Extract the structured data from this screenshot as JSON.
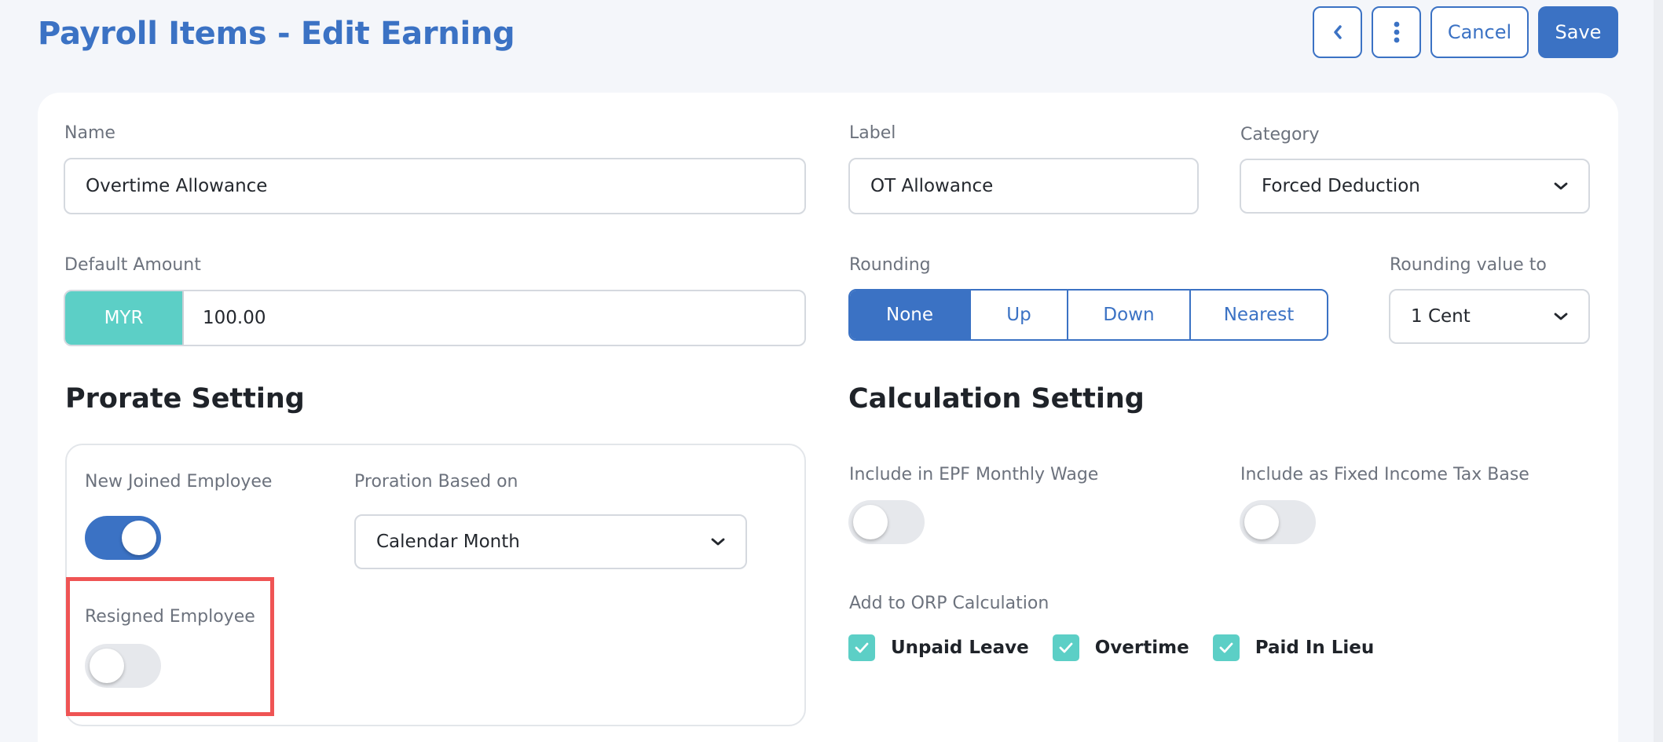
{
  "header": {
    "title": "Payroll Items - Edit Earning",
    "back_icon": "chevron-left-icon",
    "more_icon": "more-vertical-icon",
    "cancel_label": "Cancel",
    "save_label": "Save"
  },
  "form": {
    "name": {
      "label": "Name",
      "value": "Overtime Allowance"
    },
    "label_field": {
      "label": "Label",
      "value": "OT Allowance"
    },
    "category": {
      "label": "Category",
      "value": "Forced Deduction"
    },
    "default_amount": {
      "label": "Default Amount",
      "currency": "MYR",
      "value": "100.00"
    },
    "rounding": {
      "label": "Rounding",
      "options": [
        "None",
        "Up",
        "Down",
        "Nearest"
      ],
      "selected": "None"
    },
    "rounding_value": {
      "label": "Rounding value to",
      "value": "1 Cent"
    }
  },
  "prorate": {
    "title": "Prorate Setting",
    "new_joined": {
      "label": "New Joined Employee",
      "enabled": true
    },
    "proration_based_on": {
      "label": "Proration Based on",
      "value": "Calendar Month"
    },
    "resigned": {
      "label": "Resigned Employee",
      "enabled": false
    }
  },
  "calculation": {
    "title": "Calculation Setting",
    "epf": {
      "label": "Include in EPF Monthly Wage",
      "enabled": false
    },
    "fixed_income_tax": {
      "label": "Include as Fixed Income Tax Base",
      "enabled": false
    },
    "orp": {
      "label": "Add to ORP Calculation",
      "items": [
        {
          "label": "Unpaid Leave",
          "checked": true
        },
        {
          "label": "Overtime",
          "checked": true
        },
        {
          "label": "Paid In Lieu",
          "checked": true
        }
      ]
    }
  },
  "colors": {
    "primary": "#3b72c4",
    "teal": "#5ccfc6",
    "highlight": "#ef5454"
  }
}
